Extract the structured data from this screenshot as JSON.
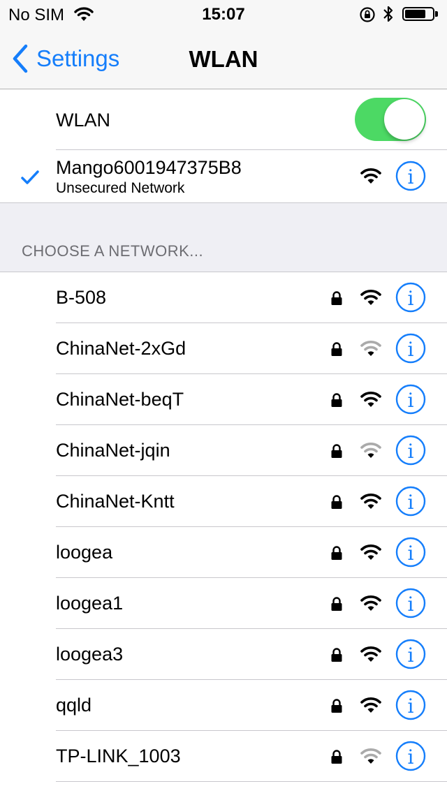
{
  "status_bar": {
    "carrier": "No SIM",
    "time": "15:07",
    "battery_percent": 75
  },
  "nav": {
    "back_label": "Settings",
    "title": "WLAN"
  },
  "wlan_toggle": {
    "label": "WLAN",
    "on": true
  },
  "current_network": {
    "name": "Mango6001947375B8",
    "subtitle": "Unsecured Network",
    "signal": "full"
  },
  "section": {
    "title": "CHOOSE A NETWORK..."
  },
  "networks": [
    {
      "name": "B-508",
      "secured": true,
      "signal": "full"
    },
    {
      "name": "ChinaNet-2xGd",
      "secured": true,
      "signal": "weak"
    },
    {
      "name": "ChinaNet-beqT",
      "secured": true,
      "signal": "full"
    },
    {
      "name": "ChinaNet-jqin",
      "secured": true,
      "signal": "weak"
    },
    {
      "name": "ChinaNet-Kntt",
      "secured": true,
      "signal": "full"
    },
    {
      "name": "loogea",
      "secured": true,
      "signal": "full"
    },
    {
      "name": "loogea1",
      "secured": true,
      "signal": "full"
    },
    {
      "name": "loogea3",
      "secured": true,
      "signal": "full"
    },
    {
      "name": "qqld",
      "secured": true,
      "signal": "full"
    },
    {
      "name": "TP-LINK_1003",
      "secured": true,
      "signal": "weak"
    }
  ],
  "colors": {
    "accent": "#157efb",
    "toggle_on": "#4cd964",
    "weak_signal": "#aaaaaa"
  },
  "icons": {
    "info": "info-circle-icon",
    "lock": "lock-icon",
    "wifi": "wifi-icon",
    "check": "checkmark-icon"
  }
}
